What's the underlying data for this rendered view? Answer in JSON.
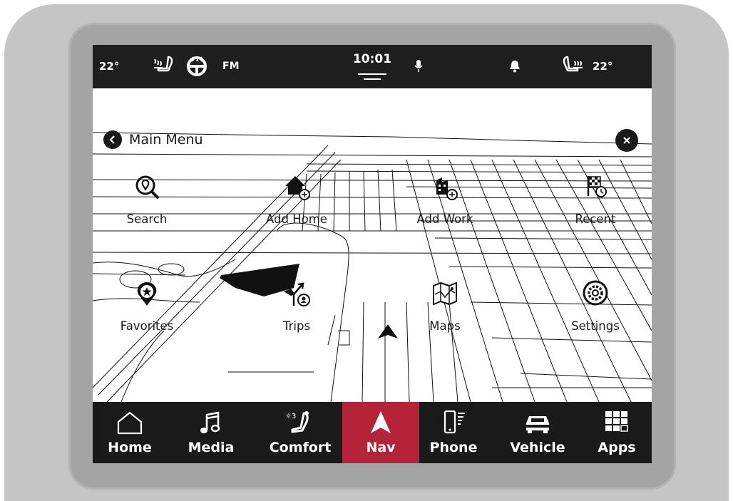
{
  "status_bar": {
    "left_temp": "22°",
    "radio": "FM",
    "time": "10:01",
    "right_temp": "22°"
  },
  "header": {
    "main_menu": "Main Menu"
  },
  "menu": {
    "search": "Search",
    "add_home": "Add Home",
    "add_work": "Add Work",
    "recent": "Recent",
    "favorites": "Favorites",
    "trips": "Trips",
    "maps": "Maps",
    "settings": "Settings"
  },
  "bottom_nav": {
    "home": "Home",
    "media": "Media",
    "comfort": "Comfort",
    "nav": "Nav",
    "phone": "Phone",
    "vehicle": "Vehicle",
    "apps": "Apps",
    "active": "Nav",
    "active_color": "#b52338"
  },
  "colors": {
    "bezel": "#c5c5c5",
    "screen_bar": "#1e1e1e"
  },
  "icons": [
    "heated-seat-icon",
    "heated-steering-icon",
    "microphone-icon",
    "bell-icon",
    "search-pin-icon",
    "home-icon",
    "work-building-icon",
    "recent-flag-icon",
    "favorite-pin-icon",
    "trips-icon",
    "maps-icon",
    "settings-gear-icon",
    "music-note-icon",
    "comfort-seat-icon",
    "nav-arrow-icon",
    "phone-icon",
    "vehicle-icon",
    "apps-grid-icon"
  ]
}
